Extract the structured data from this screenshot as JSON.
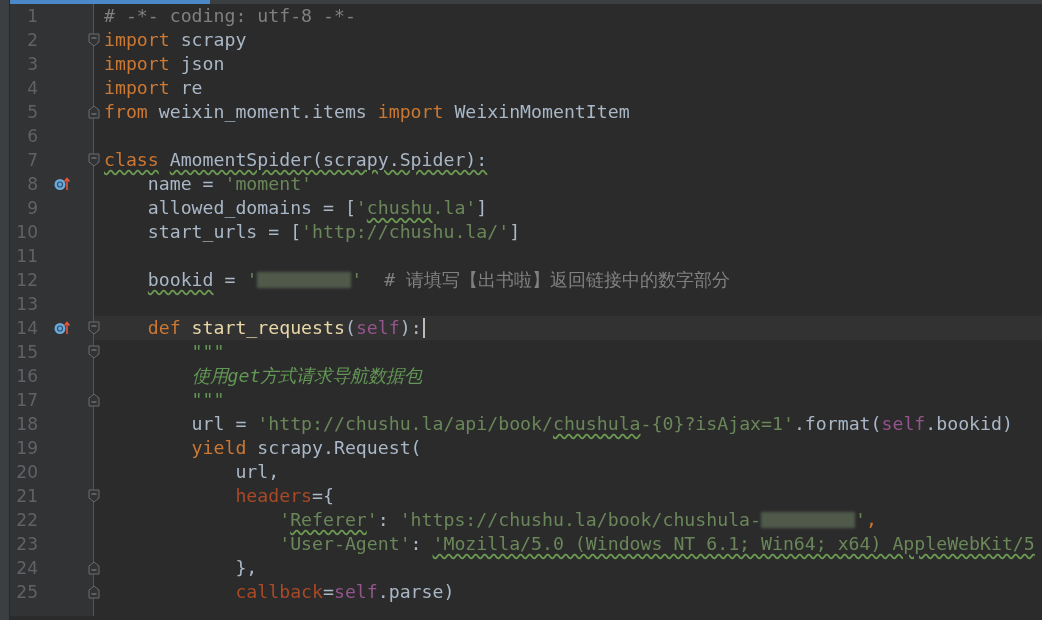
{
  "lines": [
    {
      "number": "1",
      "tokens": [
        {
          "kind": "comment",
          "text": "# -*- coding: utf-8 -*-"
        }
      ]
    },
    {
      "number": "2",
      "fold_open": true,
      "tokens": [
        {
          "kind": "keyword",
          "text": "import"
        },
        {
          "kind": "plain",
          "text": " scrapy"
        }
      ]
    },
    {
      "number": "3",
      "tokens": [
        {
          "kind": "keyword",
          "text": "import"
        },
        {
          "kind": "plain",
          "text": " json"
        }
      ]
    },
    {
      "number": "4",
      "tokens": [
        {
          "kind": "keyword",
          "text": "import"
        },
        {
          "kind": "plain",
          "text": " re"
        }
      ]
    },
    {
      "number": "5",
      "fold_close": true,
      "tokens": [
        {
          "kind": "keyword",
          "text": "from"
        },
        {
          "kind": "plain",
          "text": " weixin_moment.items "
        },
        {
          "kind": "keyword",
          "text": "import"
        },
        {
          "kind": "plain",
          "text": " WeixinMomentItem"
        }
      ]
    },
    {
      "number": "6"
    },
    {
      "number": "7",
      "fold_open": true,
      "tokens": [
        {
          "kind": "keyword",
          "text": "class",
          "typo": true
        },
        {
          "kind": "plain",
          "text": " AmomentSpider(scrapy.Spider):",
          "typo": true
        }
      ]
    },
    {
      "number": "8",
      "overridden": true,
      "tokens": [
        {
          "kind": "plain",
          "text": "    name = "
        },
        {
          "kind": "string",
          "text": "'moment'"
        }
      ]
    },
    {
      "number": "9",
      "tokens": [
        {
          "kind": "plain",
          "text": "    allowed_domains = ["
        },
        {
          "kind": "string",
          "text": "'"
        },
        {
          "kind": "string",
          "text": "chushu",
          "typo": true
        },
        {
          "kind": "string",
          "text": ".la'"
        },
        {
          "kind": "plain",
          "text": "]"
        }
      ]
    },
    {
      "number": "10",
      "tokens": [
        {
          "kind": "plain",
          "text": "    start_urls = ["
        },
        {
          "kind": "string",
          "text": "'http://chushu.la/'"
        },
        {
          "kind": "plain",
          "text": "]"
        }
      ]
    },
    {
      "number": "11"
    },
    {
      "number": "12",
      "tokens": [
        {
          "kind": "plain",
          "text": "    bookid",
          "typo": true
        },
        {
          "kind": "plain",
          "text": " = "
        },
        {
          "kind": "string",
          "text": "'"
        },
        {
          "kind": "redacted"
        },
        {
          "kind": "string",
          "text": "'"
        },
        {
          "kind": "comment",
          "text": "  # 请填写【出书啦】返回链接中的数字部分"
        }
      ]
    },
    {
      "number": "13"
    },
    {
      "number": "14",
      "overridden": true,
      "fold_open": true,
      "current": true,
      "tokens": [
        {
          "kind": "keyword",
          "text": "    def "
        },
        {
          "kind": "funcname",
          "text": "start_requests"
        },
        {
          "kind": "plain",
          "text": "("
        },
        {
          "kind": "self",
          "text": "self"
        },
        {
          "kind": "plain",
          "text": "):"
        }
      ]
    },
    {
      "number": "15",
      "fold_open": true,
      "tokens": [
        {
          "kind": "docstring",
          "text": "        \"\"\""
        }
      ]
    },
    {
      "number": "16",
      "tokens": [
        {
          "kind": "docstring",
          "text": "        使用get方式请求导航数据包"
        }
      ]
    },
    {
      "number": "17",
      "fold_close": true,
      "tokens": [
        {
          "kind": "docstring",
          "text": "        \"\"\""
        }
      ]
    },
    {
      "number": "18",
      "tokens": [
        {
          "kind": "plain",
          "text": "        url = "
        },
        {
          "kind": "string",
          "text": "'http://chushu.la/api/book/"
        },
        {
          "kind": "string",
          "text": "chushula",
          "typo": true
        },
        {
          "kind": "string",
          "text": "-{0}?isAjax=1'"
        },
        {
          "kind": "plain",
          "text": ".format("
        },
        {
          "kind": "self",
          "text": "self"
        },
        {
          "kind": "plain",
          "text": ".bookid)"
        }
      ]
    },
    {
      "number": "19",
      "tokens": [
        {
          "kind": "keyword",
          "text": "        yield"
        },
        {
          "kind": "plain",
          "text": " scrapy.Request("
        }
      ]
    },
    {
      "number": "20",
      "tokens": [
        {
          "kind": "plain",
          "text": "            url,"
        }
      ]
    },
    {
      "number": "21",
      "fold_open": true,
      "tokens": [
        {
          "kind": "kwarg",
          "text": "            headers"
        },
        {
          "kind": "plain",
          "text": "={"
        }
      ]
    },
    {
      "number": "22",
      "tokens": [
        {
          "kind": "string",
          "text": "                '"
        },
        {
          "kind": "string",
          "text": "Referer",
          "typo": true
        },
        {
          "kind": "string",
          "text": "'"
        },
        {
          "kind": "plain",
          "text": ": "
        },
        {
          "kind": "string",
          "text": "'https://chushu.la/book/chushula-"
        },
        {
          "kind": "redacted"
        },
        {
          "kind": "string",
          "text": "'"
        },
        {
          "kind": "keyword",
          "text": ","
        }
      ]
    },
    {
      "number": "23",
      "tokens": [
        {
          "kind": "string",
          "text": "                'User-Agent'"
        },
        {
          "kind": "plain",
          "text": ": "
        },
        {
          "kind": "string",
          "text": "'Mozilla/5.0 (Windows NT 6.1; Win64; x64) AppleWebKit/5",
          "typo": true
        }
      ]
    },
    {
      "number": "24",
      "fold_close": true,
      "tokens": [
        {
          "kind": "plain",
          "text": "            },"
        }
      ]
    },
    {
      "number": "25",
      "fold_close": true,
      "tokens": [
        {
          "kind": "kwarg",
          "text": "            callback"
        },
        {
          "kind": "plain",
          "text": "="
        },
        {
          "kind": "self",
          "text": "self"
        },
        {
          "kind": "plain",
          "text": ".parse)"
        }
      ]
    }
  ]
}
